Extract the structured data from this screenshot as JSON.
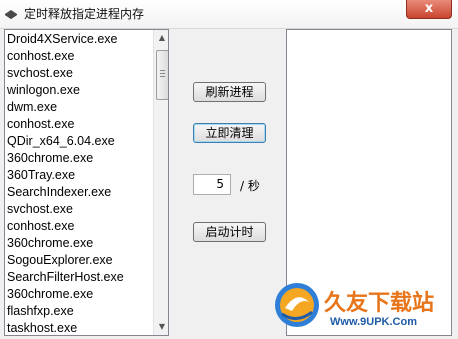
{
  "window": {
    "title": "定时释放指定进程内存",
    "close_label": "x"
  },
  "process_list": {
    "items": [
      "Droid4XService.exe",
      "conhost.exe",
      "svchost.exe",
      "winlogon.exe",
      "dwm.exe",
      "conhost.exe",
      "QDir_x64_6.04.exe",
      "360chrome.exe",
      "360Tray.exe",
      "SearchIndexer.exe",
      "svchost.exe",
      "conhost.exe",
      "360chrome.exe",
      "SogouExplorer.exe",
      "SearchFilterHost.exe",
      "360chrome.exe",
      "flashfxp.exe",
      "taskhost.exe"
    ]
  },
  "controls": {
    "refresh_label": "刷新进程",
    "clean_label": "立即清理",
    "interval_value": "5",
    "unit_label": "/ 秒",
    "timer_label": "启动计时"
  },
  "watermark": {
    "title": "久友下载站",
    "url": "Www.9UPK.Com"
  }
}
